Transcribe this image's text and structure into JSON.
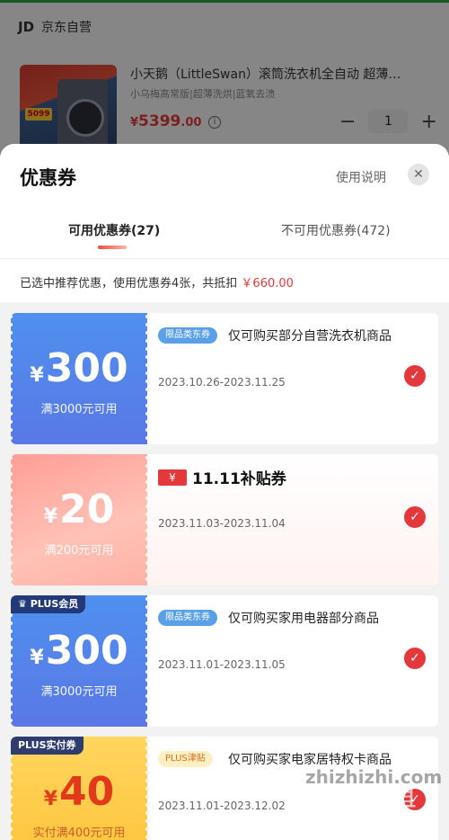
{
  "background": {
    "shop_logo": "JD",
    "shop_name": "京东自营",
    "product_title": "小天鹅（LittleSwan）滚筒洗衣机全自动 超薄…",
    "product_subtitle": "小乌梅高常版|超薄洗烘|蓝氧去渍",
    "price": {
      "currency": "¥",
      "integer": "5399",
      "decimal": ".00"
    },
    "quantity": "1",
    "image_badge": "5099"
  },
  "modal": {
    "title": "优惠券",
    "help_link": "使用说明",
    "close_icon": "close-icon"
  },
  "tabs": {
    "available": "可用优惠券(27)",
    "unavailable": "不可用优惠券(472)"
  },
  "summary": {
    "text": "已选中推荐优惠，使用优惠券4张，共抵扣",
    "amount": "￥660.00"
  },
  "coupons": [
    {
      "badge": "",
      "currency": "¥",
      "amount": "300",
      "condition": "满3000元可用",
      "tag": "限品类东券",
      "title": "仅可购买部分自营洗衣机商品",
      "date": "2023.10.26-2023.11.25",
      "selected": true
    },
    {
      "badge": "",
      "currency": "¥",
      "amount": "20",
      "condition": "满200元可用",
      "logo_box": "¥",
      "title": "11.11补贴券",
      "date": "2023.11.03-2023.11.04",
      "selected": true
    },
    {
      "badge": "PLUS会员",
      "currency": "¥",
      "amount": "300",
      "condition": "满3000元可用",
      "tag": "限品类东券",
      "title": "仅可购买家用电器部分商品",
      "date": "2023.11.01-2023.11.05",
      "selected": true
    },
    {
      "badge": "PLUS实付券",
      "currency": "¥",
      "amount": "40",
      "condition": "实付满400元可用",
      "tag": "PLUS津贴",
      "title": "仅可购买家电家居特权卡商品",
      "date": "2023.11.01-2023.12.02",
      "selected": true
    }
  ],
  "watermark": {
    "text": "zhizhizhi.com",
    "logo": "值值值"
  },
  "colors": {
    "accent": "#e4393c",
    "blue_coupon": "#5a78e6",
    "gold_coupon": "#ffc33a"
  }
}
